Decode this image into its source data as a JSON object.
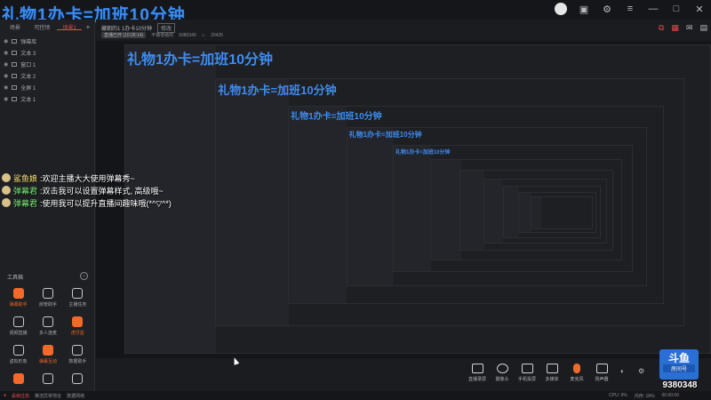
{
  "overlay_title": "礼物1办卡=加班10分钟",
  "window_controls": [
    "user-avatar",
    "skin",
    "settings",
    "menu",
    "minimize",
    "maximize",
    "close"
  ],
  "scenes": {
    "tabs": [
      "场景",
      "可控场",
      "场景1"
    ],
    "active_index": 2,
    "add_label": "+"
  },
  "sources": [
    {
      "name": "弹幕库"
    },
    {
      "name": "文本 3"
    },
    {
      "name": "窗口 1"
    },
    {
      "name": "文本 2"
    },
    {
      "name": "全屏 1"
    },
    {
      "name": "文本 1"
    }
  ],
  "header": {
    "room_title": "藏朝的1 1办卡10分钟",
    "edit_label": "修改",
    "stat_pill": "直播已开 (10:28:14)",
    "fans_label": "不做低级的",
    "fans_value": "9380340",
    "hot_value": "20425"
  },
  "tools": {
    "title": "工具箱",
    "items": [
      {
        "label": "弹幕助手",
        "highlight": true
      },
      {
        "label": "房管助手",
        "highlight": false
      },
      {
        "label": "主播任务",
        "highlight": false
      },
      {
        "label": "视频直播",
        "highlight": false
      },
      {
        "label": "多人连麦",
        "highlight": false
      },
      {
        "label": "虎牙星",
        "highlight": true
      },
      {
        "label": "虚拟形象",
        "highlight": false
      },
      {
        "label": "弹幕互动",
        "highlight": true
      },
      {
        "label": "数据助手",
        "highlight": false
      },
      {
        "label": "",
        "highlight": true
      },
      {
        "label": "",
        "highlight": false
      },
      {
        "label": "",
        "highlight": false
      }
    ]
  },
  "danmu": [
    {
      "user": "鲨鱼娘",
      "text": ":欢迎主播大大使用弹幕秀~",
      "color": "yellow"
    },
    {
      "user": "弹幕君",
      "text": ":双击我可以设置弹幕样式, 高级哦~",
      "color": "green"
    },
    {
      "user": "弹幕君",
      "text": ":使用我可以提升直播间趣味哦(*^▽^*)",
      "color": "green"
    }
  ],
  "bottom_toolbar": [
    {
      "label": "直播录屏"
    },
    {
      "label": "摄像头"
    },
    {
      "label": "手机投屏"
    },
    {
      "label": "多媒体"
    },
    {
      "label": "麦克风"
    },
    {
      "label": "扬声器"
    }
  ],
  "status_bar": {
    "warn": "丢帧过高",
    "left": [
      "推流异常地址",
      "数据网络"
    ],
    "right": [
      "CPU: 9%",
      "内存: 18%",
      "00:00:00"
    ]
  },
  "logo": {
    "brand": "斗鱼",
    "sub": "房间号",
    "room_number": "9380348"
  }
}
